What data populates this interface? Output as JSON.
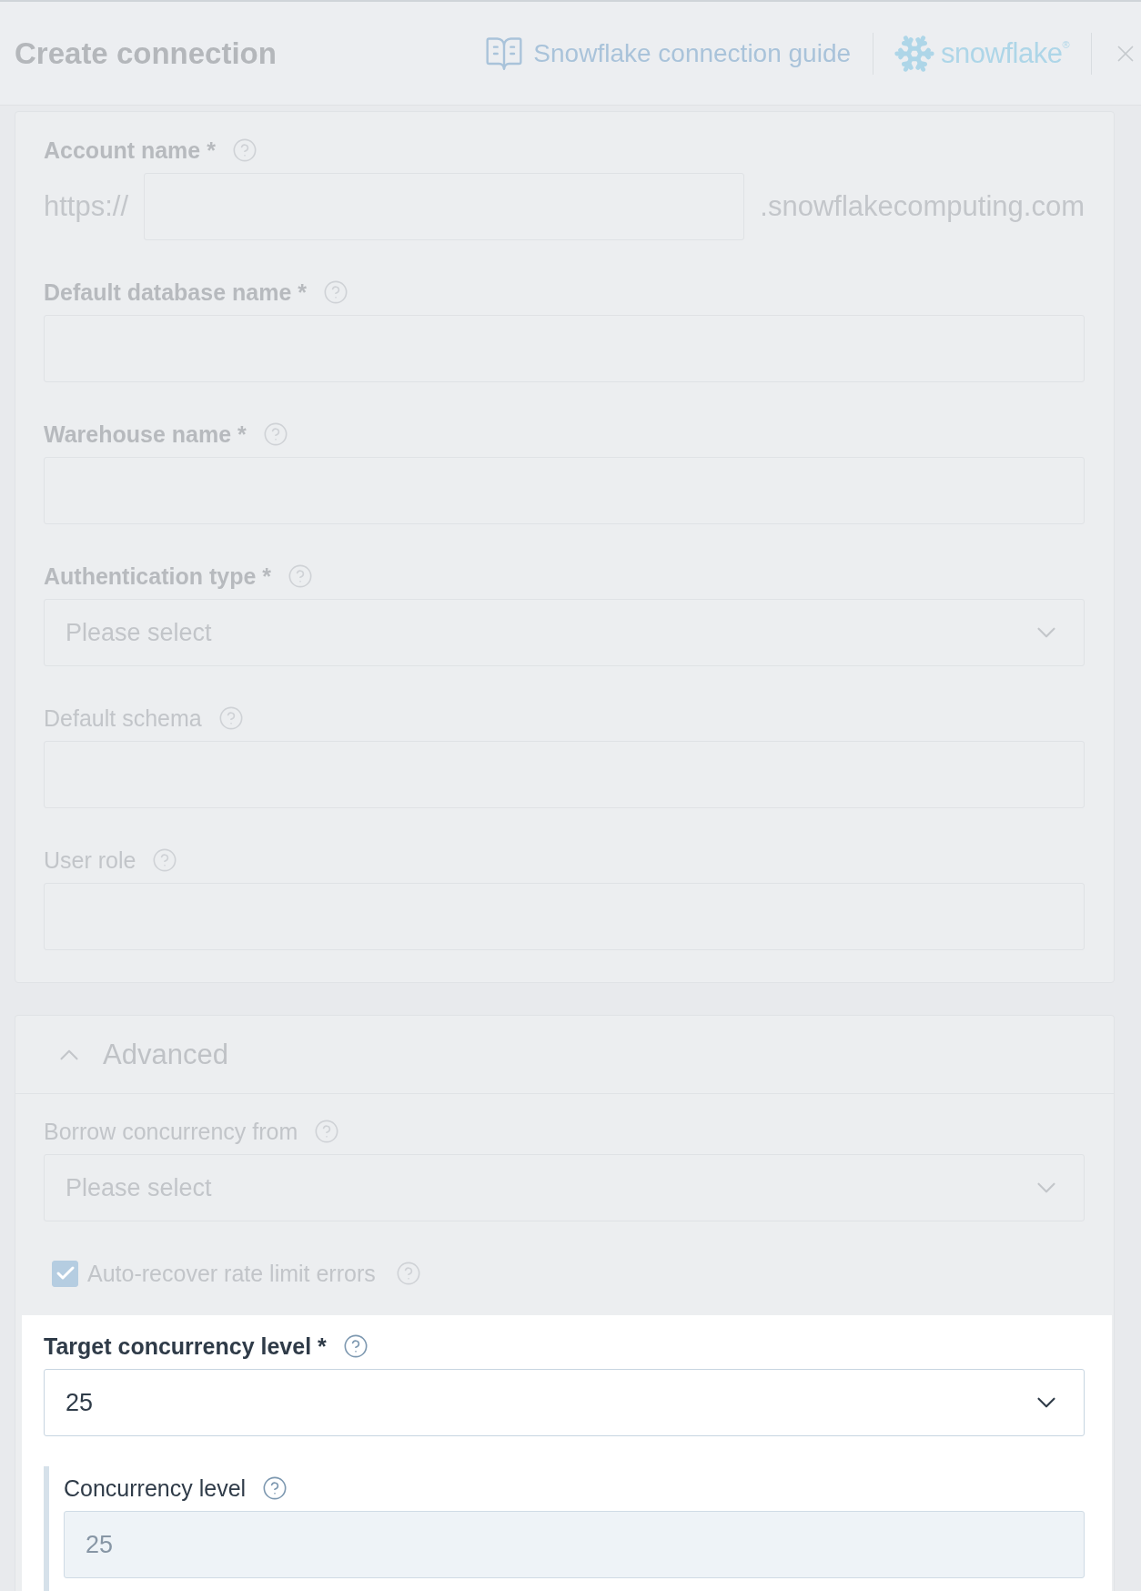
{
  "header": {
    "title": "Create connection",
    "guide_link": "Snowflake connection guide",
    "logo": "snowflake$^{®}$"
  },
  "form": {
    "fields": [
      {
        "kind": "prefixed_input",
        "label": "Account name *",
        "required": true,
        "prefix": "https://",
        "suffix": ".snowflakecomputing.com",
        "highlighted": false
      },
      {
        "kind": "input",
        "label": "Default database name *",
        "required": true,
        "highlighted": false
      },
      {
        "kind": "input",
        "label": "Warehouse name *",
        "required": true,
        "highlighted": false
      },
      {
        "kind": "select",
        "label": "Authentication type *",
        "required": true,
        "placeholder": "Please select",
        "highlighted": false
      },
      {
        "kind": "input",
        "label": "Default schema",
        "required": false,
        "highlighted": false
      },
      {
        "kind": "input",
        "label": "User role",
        "required": false,
        "highlighted": false
      }
    ]
  },
  "advanced": {
    "title": "Advanced",
    "expanded": true,
    "fields": [
      {
        "kind": "select",
        "label": "Borrow concurrency from",
        "required": false,
        "placeholder": "Please select",
        "highlighted": false
      },
      {
        "kind": "checkbox",
        "label": "Auto-recover rate limit errors",
        "checked": true,
        "highlighted": false
      },
      {
        "kind": "select",
        "label": "Target concurrency level *",
        "required": true,
        "value": "25",
        "highlighted": true,
        "children": [
          {
            "kind": "input",
            "label": "Concurrency level",
            "required": false,
            "value": "25",
            "disabled": true
          }
        ]
      }
    ]
  }
}
